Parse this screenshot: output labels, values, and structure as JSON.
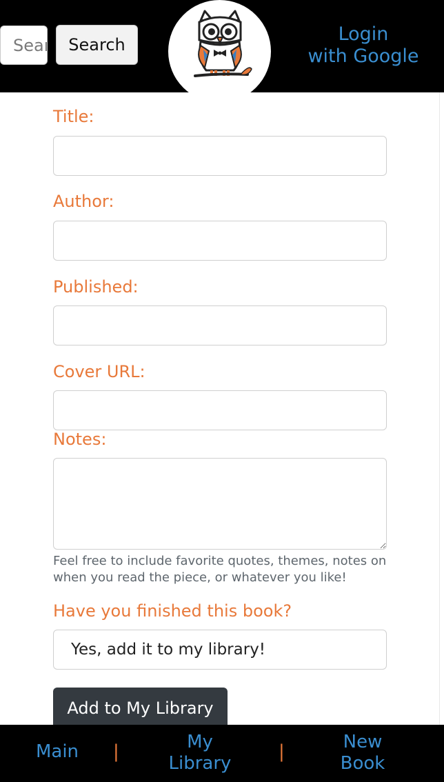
{
  "header": {
    "search_placeholder": "Search",
    "search_button_label": "Search",
    "login_line1": "Login",
    "login_line2": "with Google",
    "logo_icon": "owl-logo-icon"
  },
  "form": {
    "title_label": "Title:",
    "title_value": "",
    "author_label": "Author:",
    "author_value": "",
    "published_label": "Published:",
    "published_value": "",
    "cover_label": "Cover URL:",
    "cover_value": "",
    "notes_label": "Notes:",
    "notes_value": "",
    "notes_help": "Feel free to include favorite quotes, themes, notes on when you read the piece, or whatever you like!",
    "finished_label": "Have you finished this book?",
    "finished_selected": "Yes, add it to my library!",
    "submit_label": "Add to My Library"
  },
  "nav": {
    "main_label": "Main",
    "my_library_line1": "My",
    "my_library_line2": "Library",
    "new_book_line1": "New",
    "new_book_line2": "Book",
    "separator": "|"
  },
  "colors": {
    "label_orange": "#e8793a",
    "link_blue": "#3a8ed0",
    "header_bg": "#000000",
    "button_dark": "#343a40"
  }
}
